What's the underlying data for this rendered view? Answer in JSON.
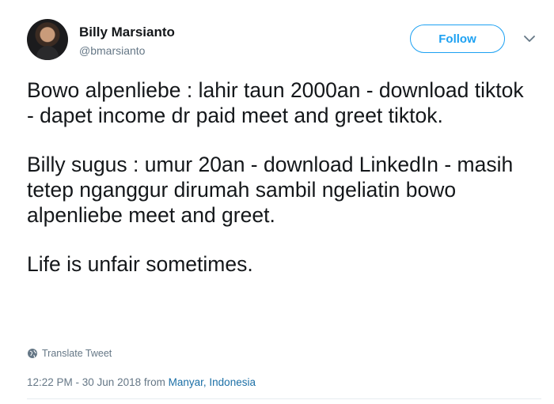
{
  "user": {
    "name": "Billy Marsianto",
    "handle": "@bmarsianto"
  },
  "follow_button": {
    "label": "Follow",
    "color": "#1da1f2"
  },
  "icons": {
    "caret": "chevron-down-icon",
    "translate": "globe-icon"
  },
  "tweet": {
    "paragraphs": [
      "Bowo alpenliebe : lahir taun 2000an - download tiktok - dapet income dr paid meet and greet tiktok.",
      "Billy sugus : umur 20an - download LinkedIn - masih tetep nganggur dirumah sambil ngeliatin bowo alpenliebe meet and greet.",
      "Life is unfair sometimes."
    ]
  },
  "translate_label": "Translate Tweet",
  "meta": {
    "time": "12:22 PM - 30 Jun 2018",
    "from_label": "from",
    "location": "Manyar, Indonesia"
  }
}
